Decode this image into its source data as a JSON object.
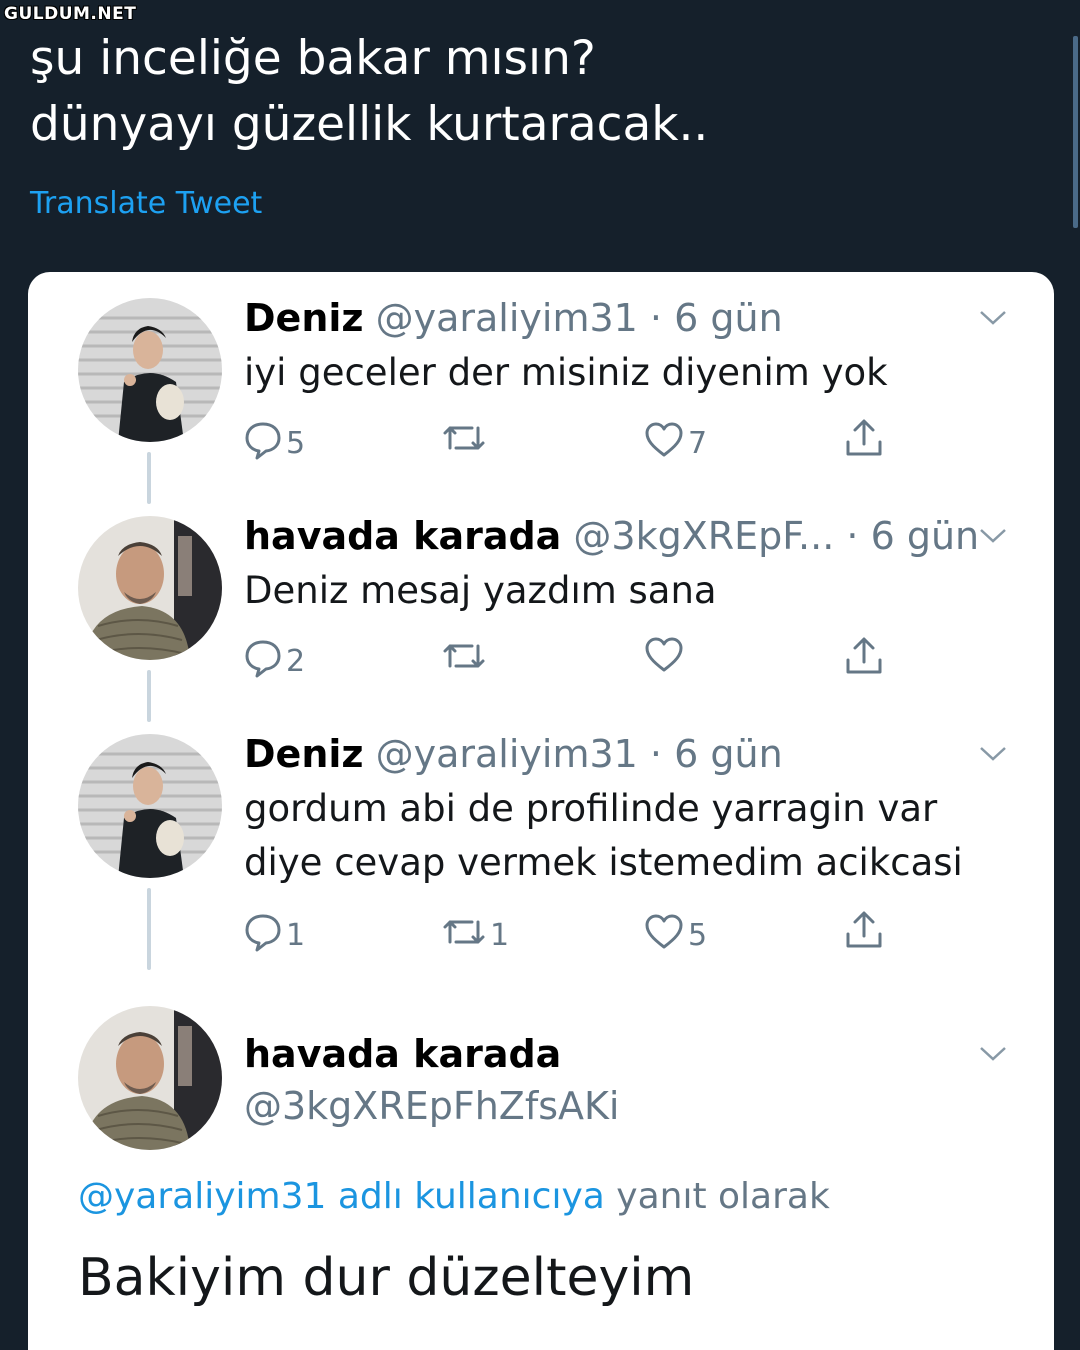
{
  "watermark": "GULDUM.NET",
  "tweet": {
    "line1": "şu inceliğe bakar mısın?",
    "line2": "dünyayı güzellik kurtaracak..",
    "translate_label": "Translate Tweet"
  },
  "replies": [
    {
      "name": "Deniz",
      "handle": "@yaraliyim31",
      "dot": "·",
      "time": "6 gün",
      "text": [
        "iyi geceler der misiniz diyenim yok"
      ],
      "comments": "5",
      "retweets": "",
      "likes": "7"
    },
    {
      "name": "havada karada",
      "handle": "@3kgXREpF...",
      "dot": "·",
      "time": "6 gün",
      "text": [
        "Deniz mesaj yazdım sana"
      ],
      "comments": "2",
      "retweets": "",
      "likes": ""
    },
    {
      "name": "Deniz",
      "handle": "@yaraliyim31",
      "dot": "·",
      "time": "6 gün",
      "text": [
        "gordum abi de profilinde yarragin var",
        "diye cevap vermek istemedim acikcasi"
      ],
      "comments": "1",
      "retweets": "1",
      "likes": "5"
    }
  ],
  "focused": {
    "name": "havada karada",
    "handle": "@3kgXREpFhZfsAKi",
    "reply_to_link": "@yaraliyim31 adlı kullanıcıya",
    "reply_to_suffix": " yanıt olarak",
    "text": "Bakiyim dur düzelteyim"
  },
  "colors": {
    "background": "#15202b",
    "accent": "#1da1f2",
    "secondary_text": "#657786"
  },
  "icons": [
    "reply-icon",
    "retweet-icon",
    "like-icon",
    "share-icon",
    "chevron-down-icon"
  ]
}
